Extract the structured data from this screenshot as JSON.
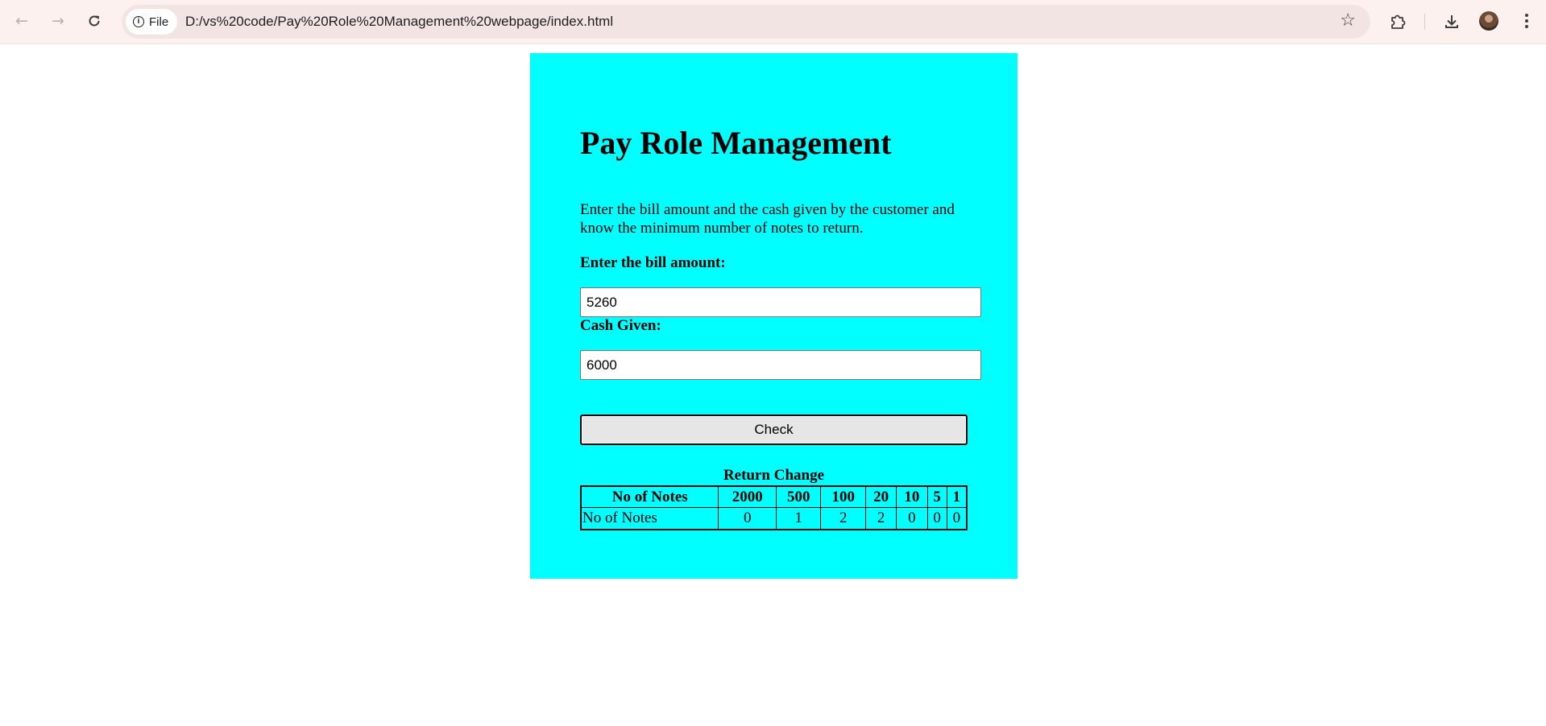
{
  "browser": {
    "site_chip_label": "File",
    "url": "D:/vs%20code/Pay%20Role%20Management%20webpage/index.html",
    "icons": {
      "back": "arrow-left-icon",
      "forward": "arrow-right-icon",
      "reload": "reload-icon",
      "info": "info-icon",
      "bookmark": "star-icon",
      "extensions": "puzzle-icon",
      "downloads": "download-icon",
      "profile": "avatar",
      "menu": "kebab-menu-icon"
    }
  },
  "page": {
    "background_color": "#00ffff",
    "title": "Pay Role Management",
    "description": "Enter the bill amount and the cash given by the customer and know the minimum number of notes to return.",
    "bill_label": "Enter the bill amount:",
    "bill_value": "5260",
    "cash_label": "Cash Given:",
    "cash_value": "6000",
    "check_button": "Check",
    "table": {
      "caption": "Return Change",
      "header_label": "No of Notes",
      "denominations": [
        "2000",
        "500",
        "100",
        "20",
        "10",
        "5",
        "1"
      ],
      "row_label": "No of Notes",
      "counts": [
        "0",
        "1",
        "2",
        "2",
        "0",
        "0",
        "0"
      ]
    }
  }
}
